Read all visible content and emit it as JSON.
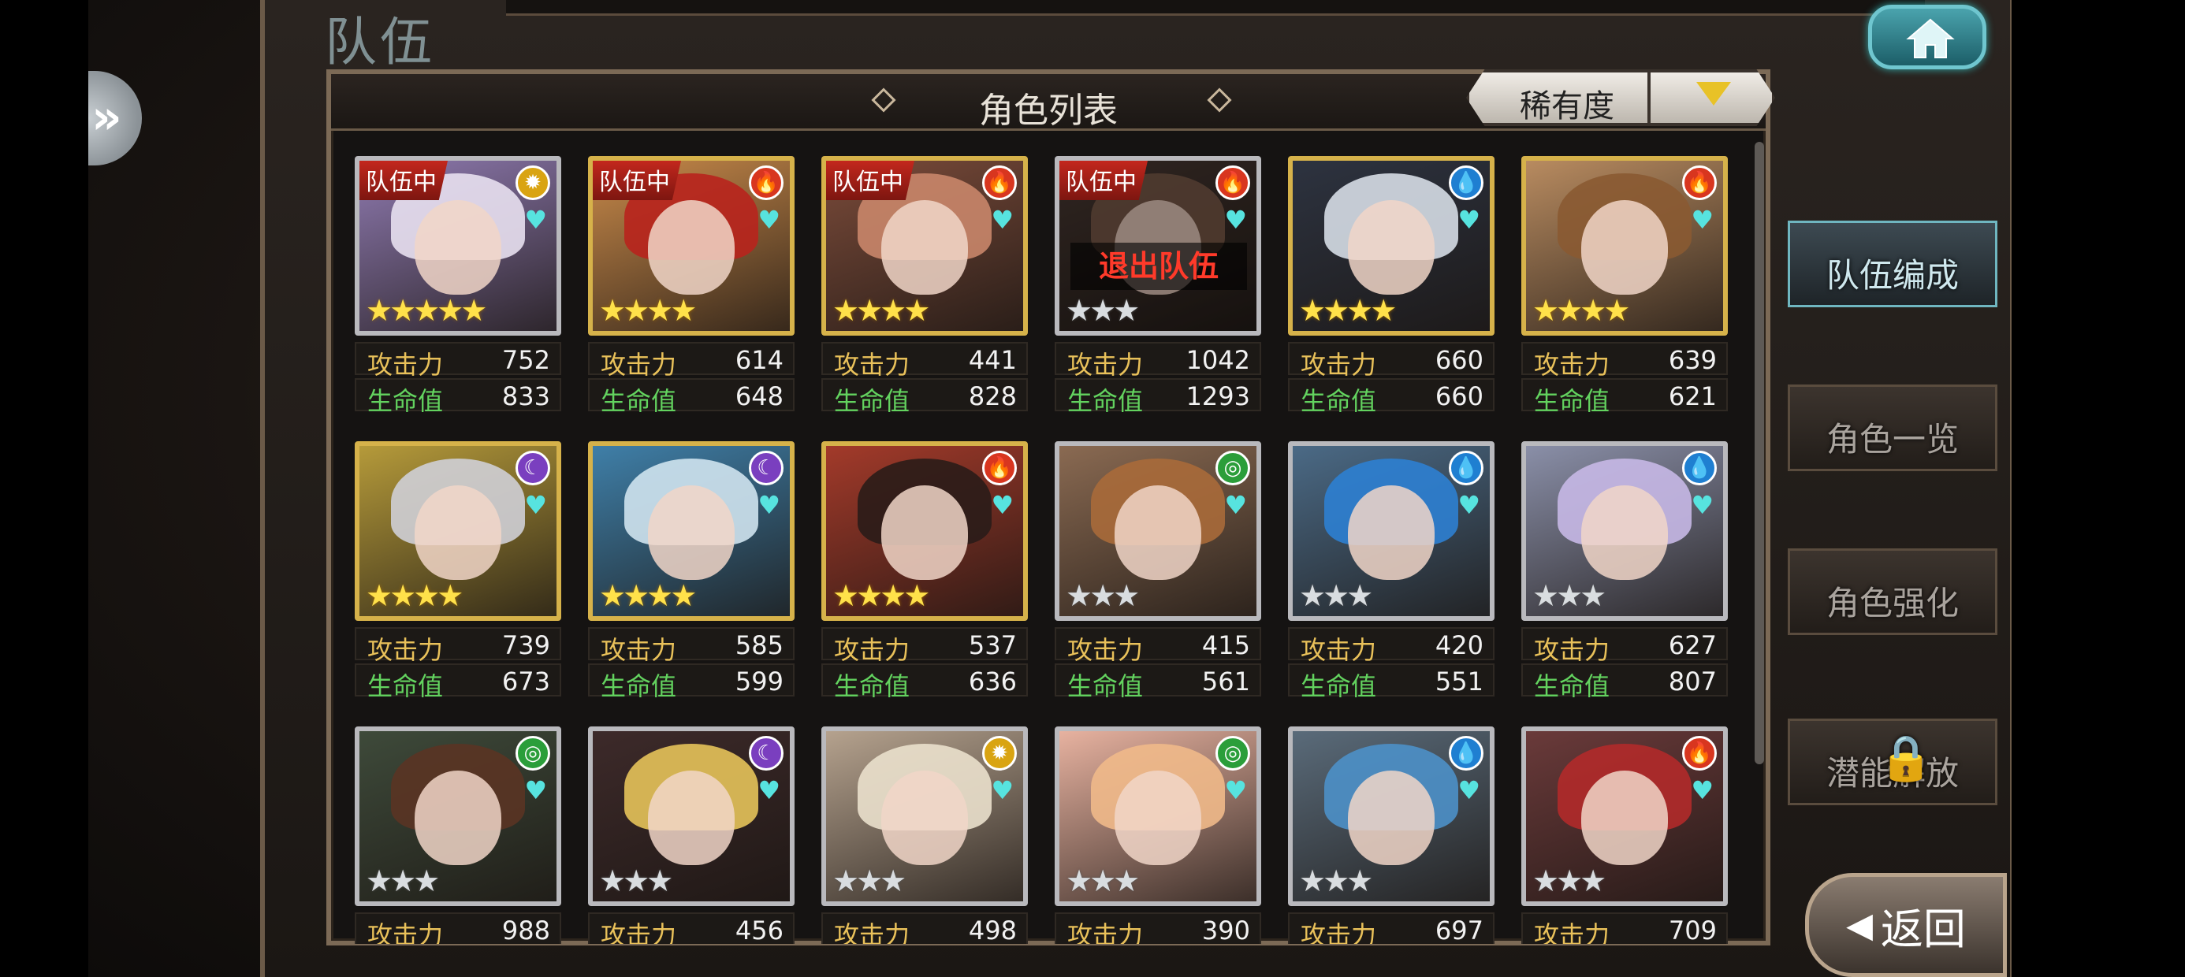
{
  "screen_title": "队伍",
  "panel": {
    "title": "角色列表"
  },
  "sort": {
    "label": "稀有度"
  },
  "right_menu": [
    {
      "label": "队伍编成",
      "active": true
    },
    {
      "label": "角色一览",
      "active": false
    },
    {
      "label": "角色强化",
      "active": false
    },
    {
      "label": "潜能解放",
      "active": false
    }
  ],
  "return_label": "返回",
  "labels": {
    "attack": "攻击力",
    "hp": "生命值",
    "in_team": "队伍中",
    "leave_team": "退出队伍"
  },
  "colors": {
    "fire": "#d8361f",
    "water": "#1f7fd1",
    "light": "#d9a412",
    "dark": "#7a3fbf",
    "wind": "#2b9e3a"
  },
  "characters": [
    {
      "in_team": true,
      "element": "light",
      "stars": 5,
      "attack": "752",
      "hp": "833",
      "frame": "silver",
      "hair": "#e8e0f0",
      "bg": "#8f7ab0"
    },
    {
      "in_team": true,
      "element": "fire",
      "stars": 4,
      "attack": "614",
      "hp": "648",
      "frame": "gold",
      "hair": "#b8231d",
      "bg": "#c98a4a"
    },
    {
      "in_team": true,
      "element": "fire",
      "stars": 4,
      "attack": "441",
      "hp": "828",
      "frame": "gold",
      "hair": "#c9866a",
      "bg": "#7b4b3a"
    },
    {
      "in_team": true,
      "element": "fire",
      "stars": 3,
      "attack": "1042",
      "hp": "1293",
      "frame": "silver",
      "hair": "#7a5a48",
      "bg": "#4a3a33",
      "leaving": true
    },
    {
      "in_team": false,
      "element": "water",
      "stars": 4,
      "attack": "660",
      "hp": "660",
      "frame": "gold",
      "hair": "#d6dde6",
      "bg": "#2d3340"
    },
    {
      "in_team": false,
      "element": "fire",
      "stars": 4,
      "attack": "639",
      "hp": "621",
      "frame": "gold",
      "hair": "#8a5a32",
      "bg": "#b88b60"
    },
    {
      "in_team": false,
      "element": "dark",
      "stars": 4,
      "attack": "739",
      "hp": "673",
      "frame": "gold",
      "hair": "#cfcfd6",
      "bg": "#b59a3a"
    },
    {
      "in_team": false,
      "element": "dark",
      "stars": 4,
      "attack": "585",
      "hp": "599",
      "frame": "gold",
      "hair": "#cfe3ee",
      "bg": "#3f7fa8"
    },
    {
      "in_team": false,
      "element": "fire",
      "stars": 4,
      "attack": "537",
      "hp": "636",
      "frame": "gold",
      "hair": "#2a1c18",
      "bg": "#a33a2a"
    },
    {
      "in_team": false,
      "element": "wind",
      "stars": 3,
      "attack": "415",
      "hp": "561",
      "frame": "silver",
      "hair": "#a86a3a",
      "bg": "#8a6a52"
    },
    {
      "in_team": false,
      "element": "water",
      "stars": 3,
      "attack": "420",
      "hp": "551",
      "frame": "silver",
      "hair": "#2e7fd2",
      "bg": "#4b6a86"
    },
    {
      "in_team": false,
      "element": "water",
      "stars": 3,
      "attack": "627",
      "hp": "807",
      "frame": "silver",
      "hair": "#c7b8e6",
      "bg": "#8a8fa8"
    },
    {
      "in_team": false,
      "element": "wind",
      "stars": 3,
      "attack": "988",
      "hp": "",
      "frame": "silver",
      "hair": "#5a3424",
      "bg": "#3e4a3a"
    },
    {
      "in_team": false,
      "element": "dark",
      "stars": 3,
      "attack": "456",
      "hp": "",
      "frame": "silver",
      "hair": "#e6c35a",
      "bg": "#3d2a2a"
    },
    {
      "in_team": false,
      "element": "light",
      "stars": 3,
      "attack": "498",
      "hp": "",
      "frame": "silver",
      "hair": "#eae0cc",
      "bg": "#b5a28e"
    },
    {
      "in_team": false,
      "element": "wind",
      "stars": 3,
      "attack": "390",
      "hp": "",
      "frame": "silver",
      "hair": "#f0b98a",
      "bg": "#e7b2a0"
    },
    {
      "in_team": false,
      "element": "water",
      "stars": 3,
      "attack": "697",
      "hp": "",
      "frame": "silver",
      "hair": "#4d90c8",
      "bg": "#5a6b7a"
    },
    {
      "in_team": false,
      "element": "fire",
      "stars": 3,
      "attack": "709",
      "hp": "",
      "frame": "silver",
      "hair": "#b12a2a",
      "bg": "#6a3a3a"
    }
  ]
}
